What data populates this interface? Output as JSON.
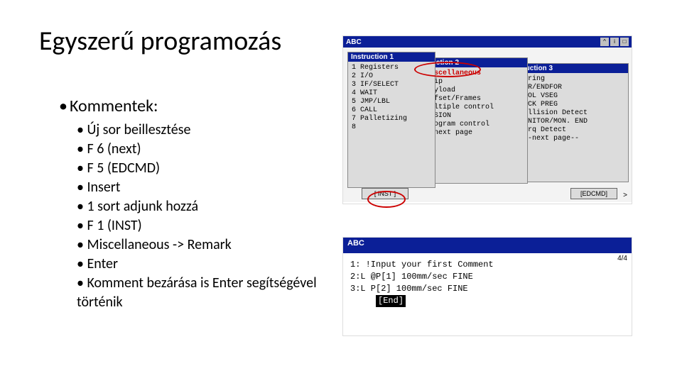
{
  "title": "Egyszerű programozás",
  "kommentek_heading": "Kommentek:",
  "bullets": [
    "Új sor beillesztése",
    "F 6 (next)",
    "F 5 (EDCMD)",
    "Insert",
    "1 sort adjunk hozzá",
    "F 1 (INST)",
    "Miscellaneous -> Remark",
    "Enter",
    "Komment bezárása is Enter segítségével történik"
  ],
  "shot1": {
    "window_title": "ABC",
    "icons": [
      "^",
      "i",
      "□"
    ],
    "paneA_title": "Instruction 1",
    "paneA_items": [
      "1 Registers",
      "2 I/O",
      "3 IF/SELECT",
      "4 WAIT",
      "5 JMP/LBL",
      "6 CALL",
      "7 Palletizing",
      "8"
    ],
    "paneB_title": "Instruction 2",
    "paneB_items": [
      "1 Miscellaneous",
      "2 Skip",
      "3 Payload",
      "4 Offset/Frames",
      "5 Multiple control",
      "6 VISION",
      "7 Program control",
      "8   next page"
    ],
    "paneC_title": "Instruction 3",
    "paneC_items": [
      "1 String",
      "2 FOR/ENDFOR",
      "3 TOOL VSEG",
      "4 LOCK PREG",
      "5 Collision Detect",
      "6 MONITOR/MON. END",
      "7 Torq Detect",
      "8  --next page--"
    ],
    "highlight_item": "1 Miscellaneous",
    "btn_left": "[ INST ]",
    "btn_right": "[EDCMD]",
    "arrow": ">"
  },
  "shot2": {
    "window_title": "ABC",
    "page": "4/4",
    "lines": [
      "  1:  !Input your first Comment",
      "  2:L @P[1] 100mm/sec FINE",
      "  3:L  P[2] 100mm/sec FINE"
    ],
    "end_label": "[End]"
  }
}
